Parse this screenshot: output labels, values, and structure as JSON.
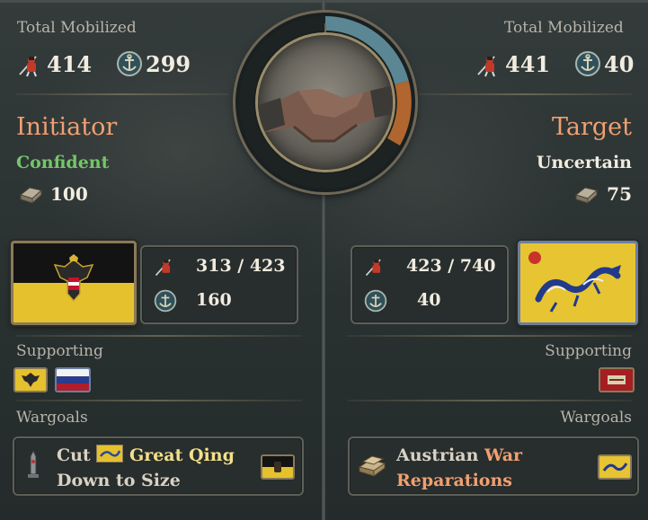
{
  "left": {
    "total_mobilized_label": "Total Mobilized",
    "army": "414",
    "navy": "299",
    "role": "Initiator",
    "stance": "Confident",
    "war_support": "100",
    "army_ratio": "313 / 423",
    "navy_count": "160",
    "supporting_label": "Supporting",
    "wargoals_label": "Wargoals",
    "wargoal": {
      "text_a": "Cut",
      "target": "Great Qing",
      "text_b": "Down to Size"
    }
  },
  "right": {
    "total_mobilized_label": "Total Mobilized",
    "army": "441",
    "navy": "40",
    "role": "Target",
    "stance": "Uncertain",
    "war_support": "75",
    "army_ratio": "423 / 740",
    "navy_count": "40",
    "supporting_label": "Supporting",
    "wargoals_label": "Wargoals",
    "wargoal": {
      "owner": "Austrian",
      "type_a": "War",
      "type_b": "Reparations"
    }
  },
  "colors": {
    "initiator": "#f0a070",
    "confident": "#76c56a",
    "highlight_yellow": "#f3e08a",
    "ring_blue": "#5b8794",
    "ring_orange": "#b0662e"
  },
  "icons": {
    "army": "soldier-icon",
    "navy": "anchor-wreath-icon",
    "war_support": "ledger-icon",
    "center": "handshake-icon"
  }
}
